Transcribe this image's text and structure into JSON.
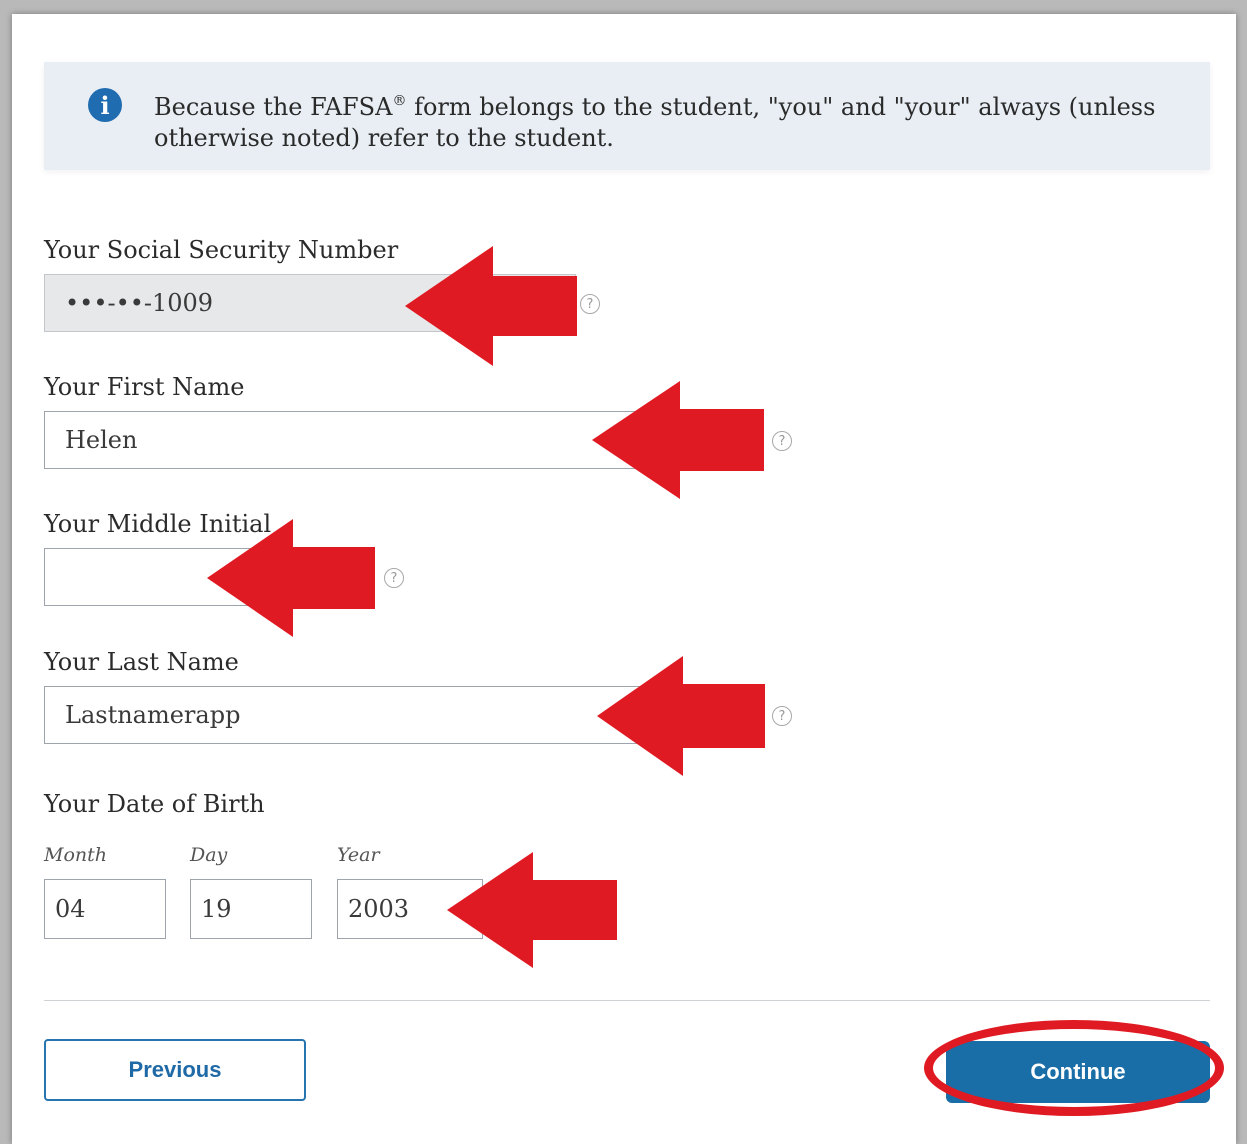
{
  "info": {
    "icon": "info-icon",
    "text_main": "Because the FAFSA",
    "text_sup": "®",
    "text_rest": " form belongs to the student, \"you\" and \"your\" always (unless otherwise noted) refer to the student."
  },
  "fields": {
    "ssn": {
      "label": "Your Social Security Number",
      "value": "•••-••-1009"
    },
    "first_name": {
      "label": "Your First Name",
      "value": "Helen"
    },
    "middle_initial": {
      "label": "Your Middle Initial",
      "value": ""
    },
    "last_name": {
      "label": "Your Last Name",
      "value": "Lastnamerapp"
    }
  },
  "dob": {
    "label": "Your Date of Birth",
    "month_label": "Month",
    "day_label": "Day",
    "year_label": "Year",
    "month": "04",
    "day": "19",
    "year": "2003"
  },
  "help_icon": "?",
  "buttons": {
    "previous": "Previous",
    "continue": "Continue"
  },
  "annotation_color": "#e01a22"
}
